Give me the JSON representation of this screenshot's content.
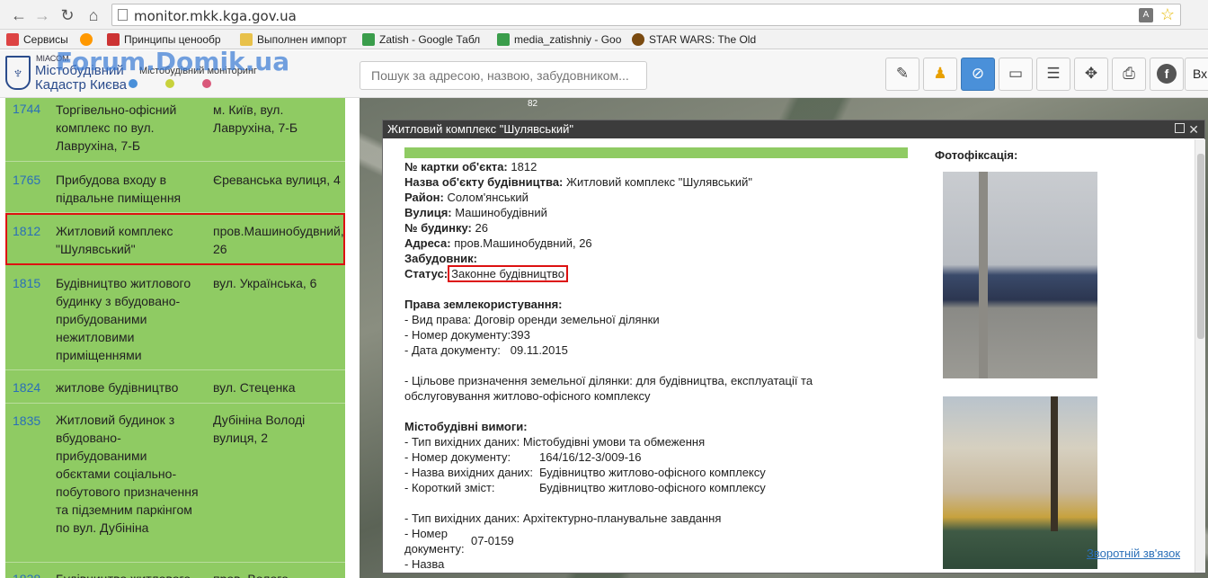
{
  "browser": {
    "url": "monitor.mkk.kga.gov.ua",
    "bookmarks": [
      {
        "label": "Сервисы",
        "color": "#d44"
      },
      {
        "label": "",
        "color": "#ff9800"
      },
      {
        "label": "Принципы ценообр",
        "color": "#c33"
      },
      {
        "label": "Выполнен импорт",
        "color": "#e8c14a"
      },
      {
        "label": "Zatish - Google Табл",
        "color": "#3a9d4b"
      },
      {
        "label": "media_zatishniy - Goo",
        "color": "#3a9d4b"
      },
      {
        "label": "STAR WARS: The Old",
        "color": "#7a4a10"
      }
    ]
  },
  "header": {
    "brand_small": "МІАСОМ",
    "brand_line1": "Містобудівний",
    "brand_line2": "Кадастр Києва",
    "brand_sub": "Містобудівний моніторинг",
    "watermark": "Forum.Domik.ua",
    "search_placeholder": "Пошук за адресою, назвою, забудовником...",
    "login_label": "Вх",
    "dot_colors": [
      "#4a90d9",
      "#c8d23c",
      "#d9587a"
    ]
  },
  "list": [
    {
      "id": "1744",
      "name": "Торгівельно-офісний комплекс по вул. Лаврухіна, 7-Б",
      "addr": "м. Київ, вул. Лаврухіна, 7-Б"
    },
    {
      "id": "1765",
      "name": "Прибудова входу в підвальне пиміщення",
      "addr": "Єреванська вулиця, 4"
    },
    {
      "id": "1812",
      "name": "Житловий комплекс \"Шулявський\"",
      "addr": "пров.Машинобудвний, 26"
    },
    {
      "id": "1815",
      "name": "Будівництво житлового будинку з вбудовано-прибудованими нежитловими приміщеннями",
      "addr": "вул. Українська, 6"
    },
    {
      "id": "1824",
      "name": "житлове будівництво",
      "addr": "вул. Стеценка"
    },
    {
      "id": "1835",
      "name": "Житловий будинок з вбудовано-прибудованими обєктами соціально-побутового призначення та підземним паркінгом по вул. Дубініна",
      "addr": "Дубініна Володі вулиця, 2"
    },
    {
      "id": "1838",
      "name": "Будівництво житлового",
      "addr": "пров. Волого"
    }
  ],
  "map": {
    "label": "82"
  },
  "popup": {
    "title": "Житловий комплекс \"Шулявський\"",
    "photos_title": "Фотофіксація:",
    "card_label": "№ картки об'єкта:",
    "card_value": "1812",
    "name_label": "Назва об'єкту будівництва:",
    "name_value": "Житловий комплекс \"Шулявський\"",
    "district_label": "Район:",
    "district_value": "Солом'янський",
    "street_label": "Вулиця:",
    "street_value": "Машинобудівний",
    "house_label": "№ будинку:",
    "house_value": "26",
    "address_label": "Адреса:",
    "address_value": "пров.Машинобудвний, 26",
    "developer_label": "Забудовник:",
    "status_label": "Статус:",
    "status_value": "Законне будівництво",
    "land_title": "Права землекористування:",
    "land_kind": "- Вид права: Договір оренди земельної ділянки",
    "land_docnum": "- Номер документу:393",
    "land_date_label": "- Дата документу:",
    "land_date_value": "09.11.2015",
    "land_purpose_1": "- Цільове призначення земельної ділянки: для будівництва, експлуатації та",
    "land_purpose_2": "обслуговування житлово-офісного комплексу",
    "req_title": "Містобудівні вимоги:",
    "req1_type": "- Тип вихідних даних: Містобудівні умови та обмеження",
    "req1_num_label": "- Номер документу:",
    "req1_num_value": "164/16/12-3/009-16",
    "req1_name_label": "- Назва вихідних даних:",
    "req1_name_value": "Будівництво житлово-офісного комплексу",
    "req1_short_label": "- Короткий зміст:",
    "req1_short_value": "Будівництво житлово-офісного комплексу",
    "req2_type": "- Тип вихідних даних: Архітектурно-планувальне завдання",
    "req2_num_label_1": "- Номер",
    "req2_num_label_2": "документу:",
    "req2_num_value": "07-0159",
    "req2_name_label": "- Назва",
    "feedback": "Зворотній зв'язок"
  }
}
